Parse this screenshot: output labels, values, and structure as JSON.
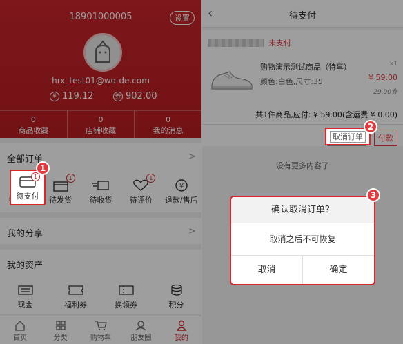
{
  "left": {
    "header": {
      "phone": "18901000005",
      "settings_label": "设置",
      "email": "hrx_test01@wo-de.com",
      "balance": "119.12",
      "balance_icon": "¥",
      "points": "902.00",
      "points_icon": "券"
    },
    "stats": [
      {
        "count": "0",
        "label": "商品收藏"
      },
      {
        "count": "0",
        "label": "店铺收藏"
      },
      {
        "count": "0",
        "label": "我的消息"
      }
    ],
    "orders": {
      "title": "全部订单",
      "items": [
        {
          "label": "待支付",
          "badge": "1"
        },
        {
          "label": "待发货",
          "badge": "1"
        },
        {
          "label": "待收货",
          "badge": ""
        },
        {
          "label": "待评价",
          "badge": "1"
        },
        {
          "label": "退款/售后",
          "badge": ""
        }
      ]
    },
    "share": {
      "title": "我的分享"
    },
    "assets": {
      "title": "我的资产",
      "items": [
        {
          "label": "现金"
        },
        {
          "label": "福利券"
        },
        {
          "label": "换领券"
        },
        {
          "label": "积分"
        }
      ]
    },
    "tabbar": [
      {
        "label": "首页",
        "icon": "home-icon"
      },
      {
        "label": "分类",
        "icon": "category-icon"
      },
      {
        "label": "购物车",
        "icon": "cart-icon"
      },
      {
        "label": "朋友圈",
        "icon": "friends-icon"
      },
      {
        "label": "我的",
        "icon": "user-icon",
        "active": true
      }
    ],
    "step1": "1"
  },
  "right": {
    "title": "待支付",
    "order": {
      "status": "未支付",
      "product_name": "购物演示测试商品（特享）",
      "spec": "颜色:白色,尺寸:35",
      "qty": "×1",
      "price": "¥ 59.00",
      "coupon": "29.00券",
      "total": "共1件商品,应付: ¥ 59.00(含运费 ¥ 0.00)",
      "cancel_label": "取消订单",
      "pay_label": "付款"
    },
    "no_more": "没有更多内容了",
    "dialog": {
      "title": "确认取消订单？",
      "message": "取消之后不可恢复",
      "cancel": "取消",
      "confirm": "确定"
    },
    "step2": "2",
    "step3": "3"
  },
  "colors": {
    "brand_red": "#c9262c",
    "highlight": "#d9252b"
  }
}
